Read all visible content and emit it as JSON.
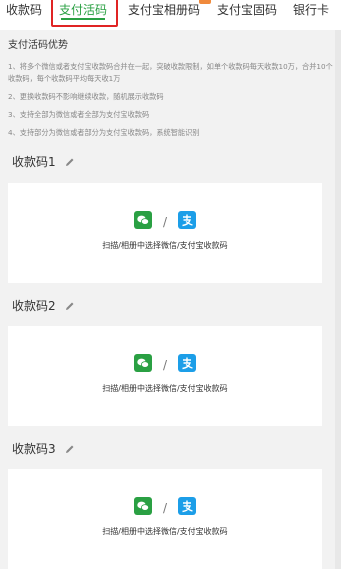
{
  "tabs": [
    {
      "label": "收款码",
      "active": false
    },
    {
      "label": "支付活码",
      "active": true
    },
    {
      "label": "支付宝相册码",
      "active": false,
      "badge": true
    },
    {
      "label": "支付宝固码",
      "active": false
    },
    {
      "label": "银行卡",
      "active": false
    }
  ],
  "intro": {
    "title": "支付活码优势",
    "lines": [
      "1、将多个微信或者支付宝收款码合并在一起，突破收款限制，如单个收款码每天收款10万，合并10个收款码，每个收款码平均每天收1万",
      "2、更换收款码不影响继续收款，随机展示收款码",
      "3、支持全部为微信或者全部为支付宝收款码",
      "4、支持部分为微信或者部分为支付宝收款码，系统智能识别"
    ]
  },
  "codes": [
    {
      "title": "收款码1",
      "hint": "扫描/相册中选择微信/支付宝收款码",
      "separator": "/"
    },
    {
      "title": "收款码2",
      "hint": "扫描/相册中选择微信/支付宝收款码",
      "separator": "/"
    },
    {
      "title": "收款码3",
      "hint": "扫描/相册中选择微信/支付宝收款码",
      "separator": "/"
    }
  ],
  "colors": {
    "accent": "#2aa043",
    "highlight_box": "#e02424",
    "wechat": "#2aa043",
    "alipay": "#1c9ee8"
  }
}
